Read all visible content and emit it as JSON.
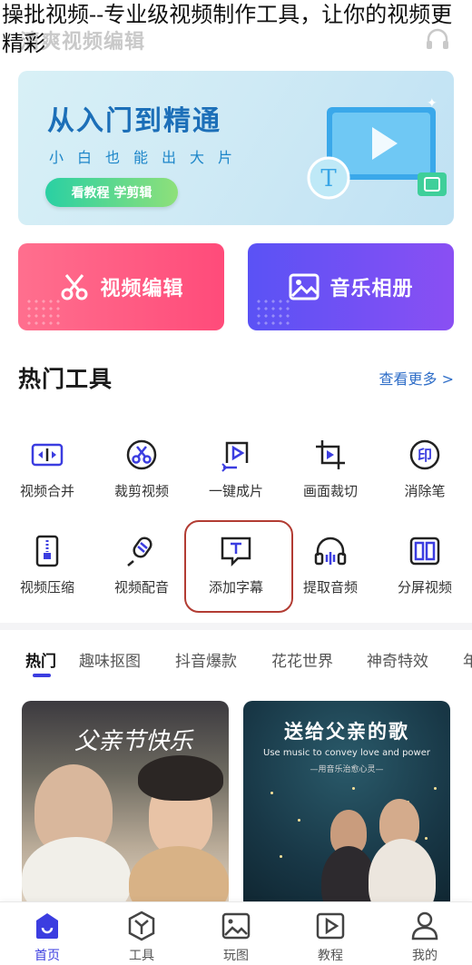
{
  "caption": "操批视频--专业级视频制作工具，让你的视频更精彩",
  "header": {
    "app_title": "清爽视频编辑"
  },
  "banner": {
    "title": "从入门到精通",
    "subtitle": "小白也能出大片",
    "button_label": "看教程 学剪辑",
    "art_letter": "T"
  },
  "quick_cards": [
    {
      "label": "视频编辑",
      "icon": "scissors-icon",
      "color": "#ff5a82"
    },
    {
      "label": "音乐相册",
      "icon": "image-icon",
      "color": "#6a50f4"
    }
  ],
  "hot_tools": {
    "title": "热门工具",
    "see_more": "查看更多 >",
    "items": [
      {
        "label": "视频合并",
        "icon": "merge-icon"
      },
      {
        "label": "裁剪视频",
        "icon": "cut-video-icon"
      },
      {
        "label": "一键成片",
        "icon": "one-click-icon"
      },
      {
        "label": "画面裁切",
        "icon": "crop-icon"
      },
      {
        "label": "消除笔",
        "icon": "eraser-icon"
      },
      {
        "label": "视频压缩",
        "icon": "compress-icon"
      },
      {
        "label": "视频配音",
        "icon": "dubbing-icon"
      },
      {
        "label": "添加字幕",
        "icon": "subtitle-icon"
      },
      {
        "label": "提取音频",
        "icon": "headphones-icon"
      },
      {
        "label": "分屏视频",
        "icon": "split-screen-icon"
      }
    ]
  },
  "tabs": [
    "热门",
    "趣味抠图",
    "抖音爆款",
    "花花世界",
    "神奇特效",
    "年"
  ],
  "active_tab": "热门",
  "tiles": [
    {
      "title": "父亲节快乐"
    },
    {
      "title": "送给父亲的歌",
      "subtitle": "Use music to convey love and power",
      "subtitle2": "—用音乐治愈心灵—"
    }
  ],
  "bottom_nav": [
    {
      "label": "首页",
      "icon": "home-icon",
      "active": true
    },
    {
      "label": "工具",
      "icon": "tools-icon",
      "active": false
    },
    {
      "label": "玩图",
      "icon": "picture-icon",
      "active": false
    },
    {
      "label": "教程",
      "icon": "tutorial-icon",
      "active": false
    },
    {
      "label": "我的",
      "icon": "profile-icon",
      "active": false
    }
  ],
  "colors": {
    "accent": "#3b3de0",
    "link": "#2f6ec8",
    "highlight_border": "#b23c33"
  }
}
